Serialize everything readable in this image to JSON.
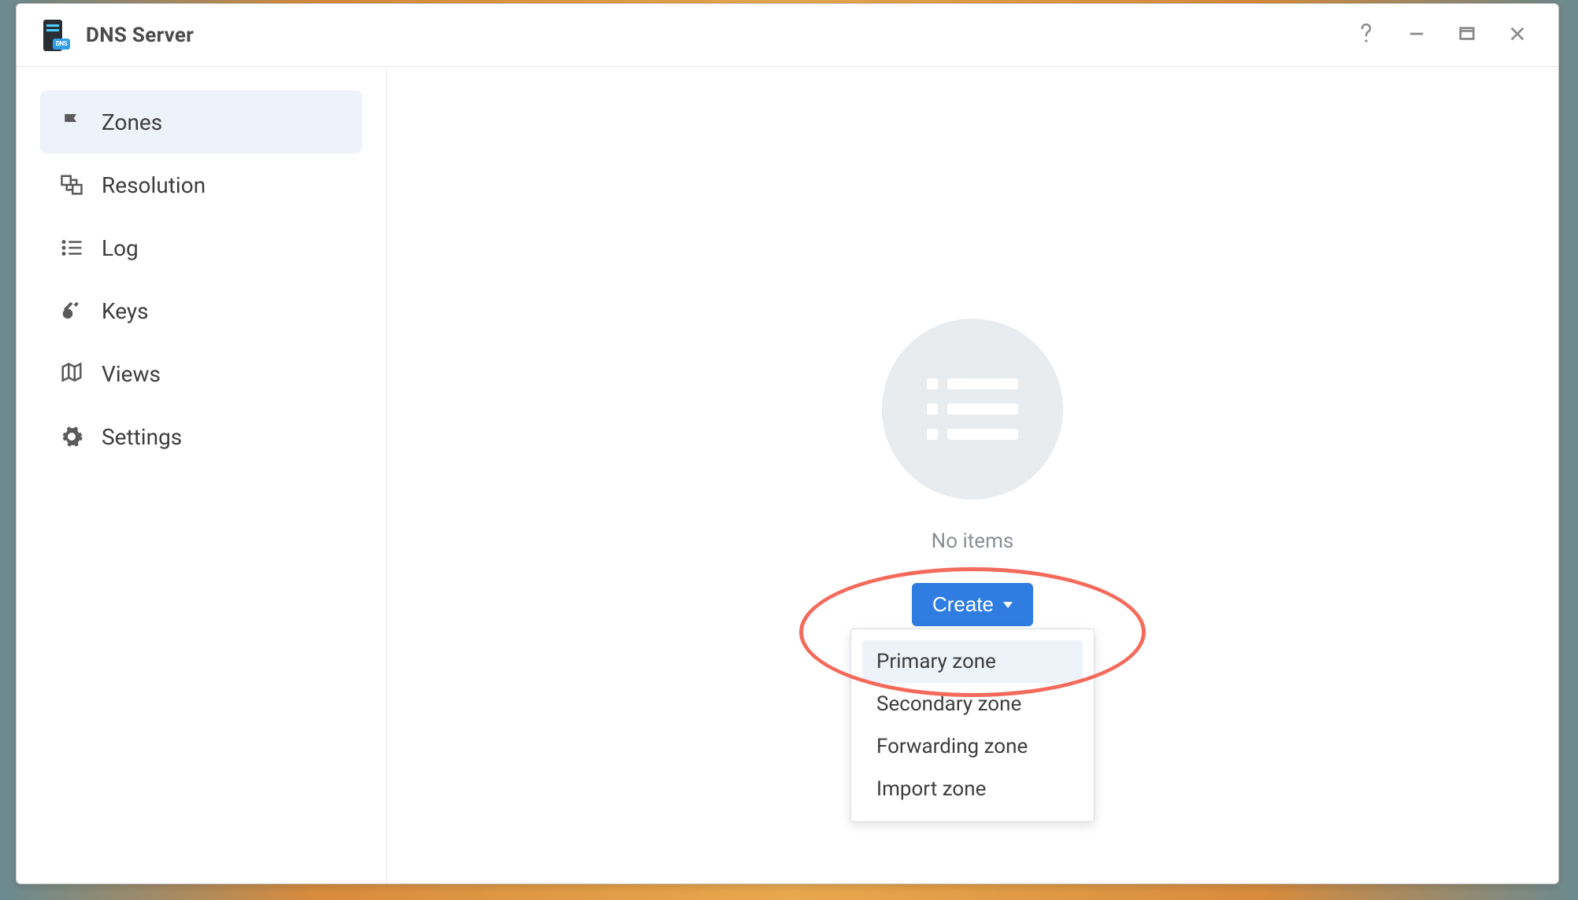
{
  "window": {
    "title": "DNS Server"
  },
  "sidebar": {
    "items": [
      {
        "label": "Zones",
        "active": true
      },
      {
        "label": "Resolution",
        "active": false
      },
      {
        "label": "Log",
        "active": false
      },
      {
        "label": "Keys",
        "active": false
      },
      {
        "label": "Views",
        "active": false
      },
      {
        "label": "Settings",
        "active": false
      }
    ]
  },
  "main": {
    "empty_text": "No items",
    "create_label": "Create",
    "create_menu": [
      "Primary zone",
      "Secondary zone",
      "Forwarding zone",
      "Import zone"
    ],
    "highlighted_menu_index": 0
  }
}
